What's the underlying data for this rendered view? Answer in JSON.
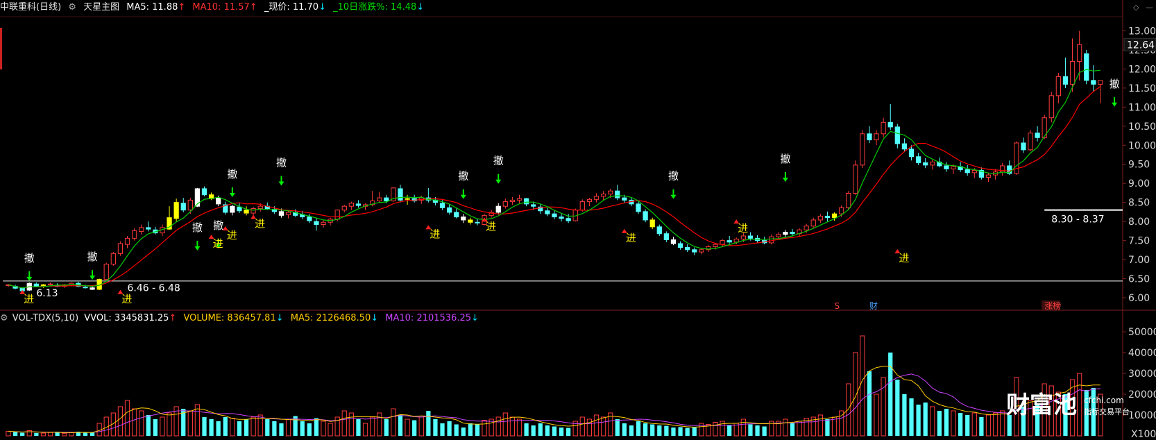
{
  "header": {
    "symbol": "中联重科(日线)",
    "indicator_icon": "gear-icon",
    "indicator": "天星主图",
    "ma5_label": "MA5: 11.88",
    "ma10_label": "MA10: 11.57",
    "price_label": "_现价: 11.70",
    "change_label": "_10日涨跌%: 14.48"
  },
  "vol_header": {
    "indicator_icon": "gear-icon",
    "name": "VOL-TDX(5,10)",
    "vvol_label": "VVOL: 3345831.25",
    "volume_label": "VOLUME: 836457.81",
    "ma5_label": "MA5: 2126468.50",
    "ma10_label": "MA10: 2101536.25"
  },
  "colors": {
    "up": "#ff3b3b",
    "down": "#54ffff",
    "ma5": "#ffffff",
    "ma10": "#ff0000",
    "green_line": "#00cc00",
    "yellow": "#ffff00",
    "vol_ma5": "#ffcc00",
    "vol_ma10": "#cc44ff",
    "grid": "#802020"
  },
  "chart_data": [
    {
      "type": "candlestick",
      "title": "中联重科(日线)",
      "ylim": [
        5.8,
        13.3
      ],
      "y_ticks": [
        "13.00",
        "12.50",
        "12.00",
        "11.50",
        "11.00",
        "10.50",
        "10.00",
        "9.50",
        "9.00",
        "8.50",
        "8.00",
        "7.50",
        "7.00",
        "6.50",
        "6.00"
      ],
      "current_price_tag": "12.64",
      "series_ohlc": [
        [
          6.32,
          6.36,
          6.28,
          6.34
        ],
        [
          6.3,
          6.34,
          6.22,
          6.25
        ],
        [
          6.25,
          6.28,
          6.13,
          6.18
        ],
        [
          6.2,
          6.4,
          6.18,
          6.38
        ],
        [
          6.36,
          6.4,
          6.28,
          6.3
        ],
        [
          6.3,
          6.36,
          6.26,
          6.34
        ],
        [
          6.34,
          6.4,
          6.3,
          6.36
        ],
        [
          6.32,
          6.38,
          6.28,
          6.3
        ],
        [
          6.3,
          6.36,
          6.26,
          6.34
        ],
        [
          6.34,
          6.4,
          6.3,
          6.38
        ],
        [
          6.38,
          6.42,
          6.28,
          6.3
        ],
        [
          6.28,
          6.34,
          6.24,
          6.26
        ],
        [
          6.26,
          6.3,
          6.2,
          6.22
        ],
        [
          6.22,
          6.5,
          6.2,
          6.48
        ],
        [
          6.48,
          6.92,
          6.46,
          6.88
        ],
        [
          6.88,
          7.2,
          6.84,
          7.16
        ],
        [
          7.16,
          7.48,
          7.1,
          7.42
        ],
        [
          7.4,
          7.62,
          7.3,
          7.56
        ],
        [
          7.56,
          7.82,
          7.5,
          7.76
        ],
        [
          7.74,
          7.92,
          7.66,
          7.84
        ],
        [
          7.84,
          8.0,
          7.74,
          7.8
        ],
        [
          7.78,
          7.86,
          7.66,
          7.7
        ],
        [
          7.7,
          7.92,
          7.62,
          7.84
        ],
        [
          7.8,
          8.4,
          7.78,
          8.1
        ],
        [
          8.08,
          8.6,
          8.0,
          8.5
        ],
        [
          8.48,
          8.62,
          8.24,
          8.3
        ],
        [
          8.3,
          8.62,
          8.2,
          8.56
        ],
        [
          8.4,
          8.88,
          8.38,
          8.86
        ],
        [
          8.86,
          8.92,
          8.66,
          8.7
        ],
        [
          8.7,
          8.76,
          8.56,
          8.6
        ],
        [
          8.62,
          8.68,
          8.4,
          8.46
        ],
        [
          8.44,
          8.52,
          8.18,
          8.24
        ],
        [
          8.24,
          8.44,
          8.16,
          8.4
        ],
        [
          8.38,
          8.48,
          8.22,
          8.28
        ],
        [
          8.3,
          8.4,
          8.16,
          8.22
        ],
        [
          8.22,
          8.38,
          8.14,
          8.34
        ],
        [
          8.34,
          8.48,
          8.26,
          8.4
        ],
        [
          8.4,
          8.5,
          8.3,
          8.34
        ],
        [
          8.32,
          8.4,
          8.2,
          8.26
        ],
        [
          8.26,
          8.34,
          8.1,
          8.16
        ],
        [
          8.18,
          8.3,
          8.08,
          8.24
        ],
        [
          8.24,
          8.32,
          8.12,
          8.16
        ],
        [
          8.18,
          8.28,
          8.06,
          8.12
        ],
        [
          8.12,
          8.2,
          7.96,
          8.02
        ],
        [
          8.0,
          8.1,
          7.76,
          7.92
        ],
        [
          7.92,
          8.04,
          7.84,
          7.98
        ],
        [
          7.98,
          8.1,
          7.9,
          8.06
        ],
        [
          8.06,
          8.32,
          8.0,
          8.3
        ],
        [
          8.3,
          8.44,
          8.24,
          8.4
        ],
        [
          8.4,
          8.52,
          8.3,
          8.48
        ],
        [
          8.46,
          8.56,
          8.36,
          8.42
        ],
        [
          8.4,
          8.48,
          8.3,
          8.44
        ],
        [
          8.44,
          8.8,
          8.4,
          8.54
        ],
        [
          8.54,
          8.78,
          8.5,
          8.62
        ],
        [
          8.62,
          8.7,
          8.48,
          8.54
        ],
        [
          8.54,
          8.9,
          8.52,
          8.88
        ],
        [
          8.86,
          8.96,
          8.5,
          8.56
        ],
        [
          8.58,
          8.7,
          8.44,
          8.6
        ],
        [
          8.6,
          8.7,
          8.5,
          8.54
        ],
        [
          8.56,
          8.68,
          8.46,
          8.62
        ],
        [
          8.62,
          8.88,
          8.5,
          8.56
        ],
        [
          8.56,
          8.64,
          8.42,
          8.5
        ],
        [
          8.48,
          8.56,
          8.3,
          8.36
        ],
        [
          8.36,
          8.46,
          8.18,
          8.24
        ],
        [
          8.24,
          8.34,
          8.08,
          8.12
        ],
        [
          8.12,
          8.2,
          7.96,
          8.04
        ],
        [
          8.04,
          8.1,
          7.92,
          7.98
        ],
        [
          7.98,
          8.06,
          7.9,
          7.96
        ],
        [
          7.92,
          8.2,
          7.9,
          8.16
        ],
        [
          8.16,
          8.3,
          8.1,
          8.24
        ],
        [
          8.24,
          8.48,
          8.18,
          8.4
        ],
        [
          8.4,
          8.6,
          8.34,
          8.52
        ],
        [
          8.52,
          8.64,
          8.44,
          8.56
        ],
        [
          8.56,
          8.7,
          8.48,
          8.6
        ],
        [
          8.6,
          8.62,
          8.4,
          8.46
        ],
        [
          8.44,
          8.52,
          8.3,
          8.4
        ],
        [
          8.38,
          8.46,
          8.2,
          8.28
        ],
        [
          8.28,
          8.36,
          8.14,
          8.2
        ],
        [
          8.2,
          8.3,
          8.06,
          8.12
        ],
        [
          8.12,
          8.2,
          8.0,
          8.08
        ],
        [
          8.08,
          8.2,
          7.96,
          8.02
        ],
        [
          8.02,
          8.34,
          8.0,
          8.3
        ],
        [
          8.3,
          8.58,
          8.26,
          8.52
        ],
        [
          8.52,
          8.62,
          8.4,
          8.58
        ],
        [
          8.58,
          8.74,
          8.5,
          8.66
        ],
        [
          8.66,
          8.8,
          8.56,
          8.72
        ],
        [
          8.72,
          8.86,
          8.62,
          8.8
        ],
        [
          8.8,
          8.96,
          8.56,
          8.62
        ],
        [
          8.62,
          8.7,
          8.48,
          8.56
        ],
        [
          8.56,
          8.62,
          8.4,
          8.46
        ],
        [
          8.46,
          8.52,
          8.2,
          8.26
        ],
        [
          8.26,
          8.32,
          7.98,
          8.04
        ],
        [
          8.04,
          8.1,
          7.8,
          7.86
        ],
        [
          7.86,
          7.92,
          7.62,
          7.68
        ],
        [
          7.68,
          7.74,
          7.46,
          7.52
        ],
        [
          7.52,
          7.6,
          7.38,
          7.42
        ],
        [
          7.42,
          7.48,
          7.26,
          7.32
        ],
        [
          7.32,
          7.4,
          7.2,
          7.26
        ],
        [
          7.26,
          7.32,
          7.12,
          7.2
        ],
        [
          7.2,
          7.3,
          7.14,
          7.26
        ],
        [
          7.26,
          7.38,
          7.2,
          7.34
        ],
        [
          7.34,
          7.44,
          7.26,
          7.4
        ],
        [
          7.4,
          7.54,
          7.34,
          7.5
        ],
        [
          7.5,
          7.62,
          7.42,
          7.46
        ],
        [
          7.46,
          7.58,
          7.4,
          7.54
        ],
        [
          7.54,
          7.7,
          7.46,
          7.62
        ],
        [
          7.62,
          7.72,
          7.5,
          7.56
        ],
        [
          7.56,
          7.64,
          7.44,
          7.5
        ],
        [
          7.5,
          7.6,
          7.4,
          7.44
        ],
        [
          7.44,
          7.66,
          7.4,
          7.6
        ],
        [
          7.6,
          7.72,
          7.52,
          7.66
        ],
        [
          7.66,
          7.78,
          7.58,
          7.72
        ],
        [
          7.72,
          7.8,
          7.62,
          7.68
        ],
        [
          7.68,
          7.82,
          7.6,
          7.78
        ],
        [
          7.78,
          7.94,
          7.7,
          7.88
        ],
        [
          7.88,
          8.1,
          7.82,
          8.04
        ],
        [
          8.04,
          8.2,
          7.96,
          8.14
        ],
        [
          8.14,
          8.26,
          8.0,
          8.1
        ],
        [
          8.1,
          8.24,
          8.02,
          8.2
        ],
        [
          8.2,
          8.42,
          8.12,
          8.36
        ],
        [
          8.36,
          8.8,
          8.3,
          8.74
        ],
        [
          8.74,
          9.6,
          8.7,
          9.48
        ],
        [
          9.48,
          10.4,
          9.4,
          10.3
        ],
        [
          10.3,
          10.5,
          10.06,
          10.14
        ],
        [
          10.14,
          10.4,
          10.0,
          10.3
        ],
        [
          10.3,
          10.72,
          10.2,
          10.6
        ],
        [
          10.6,
          11.08,
          10.4,
          10.48
        ],
        [
          10.48,
          10.56,
          9.92,
          10.04
        ],
        [
          10.04,
          10.18,
          9.82,
          9.9
        ],
        [
          9.9,
          10.0,
          9.6,
          9.7
        ],
        [
          9.7,
          9.8,
          9.48,
          9.54
        ],
        [
          9.54,
          9.66,
          9.4,
          9.48
        ],
        [
          9.48,
          9.62,
          9.36,
          9.56
        ],
        [
          9.56,
          9.68,
          9.42,
          9.46
        ],
        [
          9.46,
          9.56,
          9.3,
          9.38
        ],
        [
          9.38,
          9.5,
          9.24,
          9.44
        ],
        [
          9.44,
          9.56,
          9.3,
          9.36
        ],
        [
          9.36,
          9.48,
          9.2,
          9.28
        ],
        [
          9.28,
          9.4,
          9.14,
          9.34
        ],
        [
          9.34,
          9.42,
          9.1,
          9.16
        ],
        [
          9.16,
          9.28,
          9.04,
          9.22
        ],
        [
          9.22,
          9.38,
          9.1,
          9.3
        ],
        [
          9.3,
          9.54,
          9.2,
          9.46
        ],
        [
          9.46,
          9.6,
          9.22,
          9.26
        ],
        [
          9.26,
          10.1,
          9.22,
          10.06
        ],
        [
          10.06,
          10.2,
          9.8,
          9.88
        ],
        [
          9.88,
          10.4,
          9.84,
          10.32
        ],
        [
          10.32,
          10.5,
          10.1,
          10.2
        ],
        [
          10.2,
          10.8,
          10.16,
          10.72
        ],
        [
          10.72,
          11.4,
          10.6,
          11.3
        ],
        [
          11.3,
          11.9,
          11.1,
          11.8
        ],
        [
          11.8,
          12.3,
          11.5,
          11.6
        ],
        [
          11.6,
          12.8,
          11.4,
          12.2
        ],
        [
          12.2,
          13.0,
          11.7,
          12.64
        ],
        [
          12.4,
          12.5,
          11.6,
          11.7
        ],
        [
          11.7,
          12.1,
          11.4,
          11.6
        ],
        [
          11.6,
          11.7,
          11.1,
          11.7
        ]
      ],
      "labels": [
        {
          "text": "撤",
          "i": 3,
          "price": 6.95
        },
        {
          "text": "撤",
          "i": 12,
          "price": 6.98
        },
        {
          "text": "撤",
          "i": 27,
          "price": 7.75
        },
        {
          "text": "撤",
          "i": 30,
          "price": 7.8
        },
        {
          "text": "撤",
          "i": 32,
          "price": 9.15
        },
        {
          "text": "撤",
          "i": 39,
          "price": 9.45
        },
        {
          "text": "撤",
          "i": 65,
          "price": 9.1
        },
        {
          "text": "撤",
          "i": 70,
          "price": 9.5
        },
        {
          "text": "撤",
          "i": 95,
          "price": 9.1
        },
        {
          "text": "撤",
          "i": 111,
          "price": 9.55
        },
        {
          "text": "撤",
          "i": 158,
          "price": 11.52
        },
        {
          "text": "进",
          "i": 2,
          "price": 5.95
        },
        {
          "text": "进",
          "i": 16,
          "price": 5.95
        },
        {
          "text": "进",
          "i": 29,
          "price": 7.4
        },
        {
          "text": "进",
          "i": 31,
          "price": 7.62
        },
        {
          "text": "进",
          "i": 35,
          "price": 7.92
        },
        {
          "text": "进",
          "i": 60,
          "price": 7.65
        },
        {
          "text": "进",
          "i": 68,
          "price": 7.85
        },
        {
          "text": "进",
          "i": 88,
          "price": 7.55
        },
        {
          "text": "进",
          "i": 104,
          "price": 7.8
        },
        {
          "text": "进",
          "i": 127,
          "price": 7.02
        },
        {
          "text": "进",
          "i": 179,
          "price": 8.7
        }
      ],
      "annotations": [
        {
          "text": "6.13",
          "i": 4,
          "price": 6.13
        },
        {
          "text": "6.46 - 6.48",
          "i": 17,
          "price": 6.26
        },
        {
          "text": "8.30 - 8.37",
          "i": 149,
          "price": 8.07
        },
        {
          "text": "13.00",
          "i": 190,
          "price": 13.05
        }
      ],
      "level_lines": [
        6.44,
        8.3
      ],
      "events": [
        {
          "text": "S",
          "i": 118
        },
        {
          "text": "财",
          "i": 123
        },
        {
          "text": "涨榜",
          "i": 148
        }
      ]
    },
    {
      "type": "bar",
      "title": "VOL-TDX(5,10)",
      "ylim": [
        0,
        52000
      ],
      "y_ticks": [
        "50000",
        "40000",
        "30000",
        "20000",
        "10000"
      ],
      "unit_label": "X100",
      "volume": [
        2200,
        1800,
        1500,
        2500,
        1400,
        1300,
        1600,
        1900,
        1200,
        1500,
        2000,
        1700,
        1600,
        6000,
        9000,
        11000,
        14000,
        17000,
        13000,
        12000,
        10000,
        8000,
        9000,
        11000,
        14000,
        13000,
        12000,
        15000,
        9000,
        8000,
        7000,
        9000,
        8500,
        7000,
        8000,
        9000,
        10000,
        8000,
        7000,
        6000,
        8000,
        9500,
        7000,
        6000,
        8500,
        7000,
        6000,
        9000,
        12000,
        11000,
        8000,
        6000,
        9000,
        11000,
        8000,
        13000,
        10000,
        8000,
        7500,
        9500,
        12000,
        8000,
        6000,
        7000,
        5500,
        4000,
        6000,
        5500,
        7500,
        8000,
        9000,
        11000,
        9000,
        8000,
        6000,
        5000,
        6000,
        5000,
        4500,
        4000,
        3800,
        7000,
        9000,
        8000,
        10000,
        9000,
        11000,
        8000,
        6000,
        5000,
        7000,
        6000,
        5500,
        5000,
        4800,
        4000,
        4200,
        3800,
        4000,
        6000,
        5500,
        6500,
        7000,
        5000,
        6000,
        8000,
        5500,
        5000,
        4500,
        7000,
        7000,
        8000,
        6000,
        7000,
        8500,
        9000,
        10000,
        8000,
        9000,
        12000,
        25000,
        40000,
        48000,
        31000,
        20000,
        28000,
        40000,
        27000,
        20000,
        18000,
        15000,
        16000,
        14000,
        12000,
        13000,
        12000,
        11000,
        10000,
        11000,
        9000,
        10000,
        11000,
        12000,
        10000,
        28000,
        14000,
        17000,
        15000,
        25000,
        24000,
        21000,
        20000,
        27000,
        30000,
        22000,
        23000,
        20000
      ],
      "vol_ma5_series": "derived",
      "vol_ma10_series": "derived"
    }
  ],
  "watermark": {
    "logo_text": "财富池",
    "domain": "cfchi.com",
    "tagline": "指标交易平台"
  }
}
